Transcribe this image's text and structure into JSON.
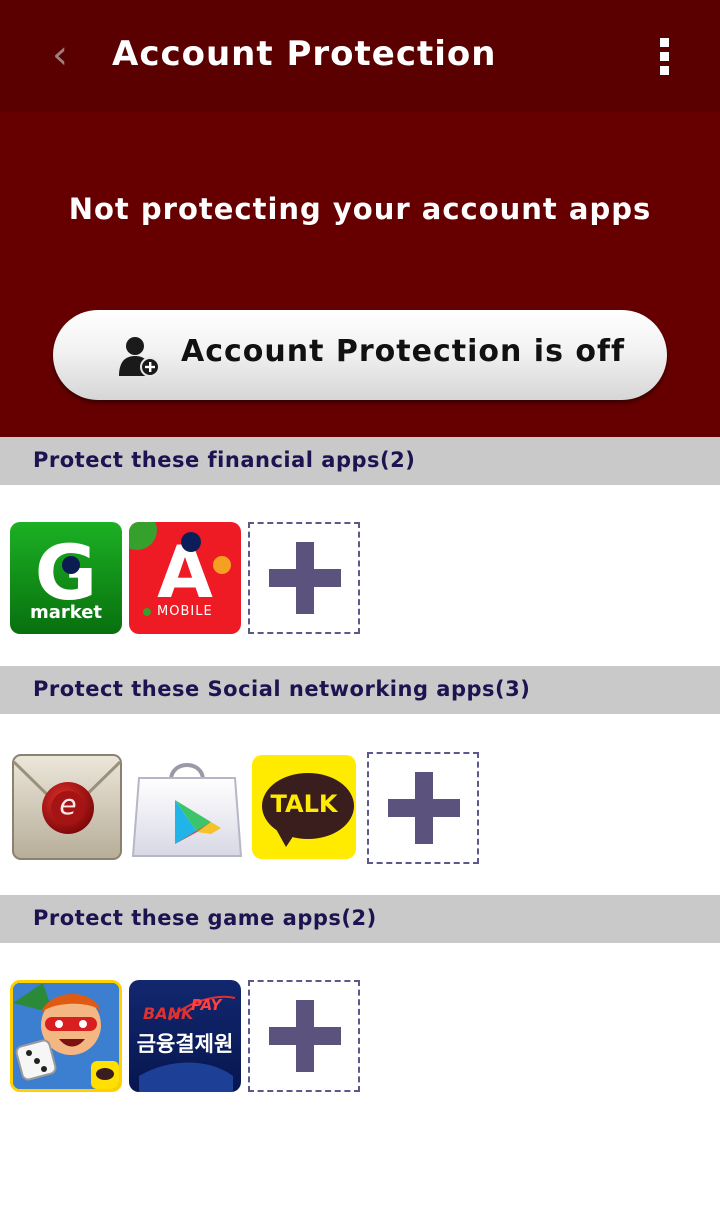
{
  "header": {
    "title": "Account Protection",
    "back_icon": "back-chevron-icon",
    "menu_icon": "overflow-menu-icon"
  },
  "hero": {
    "status_text": "Not protecting your account apps",
    "toggle_label": "Account Protection is off",
    "toggle_icon": "user-shield-icon"
  },
  "sections": [
    {
      "title": "Protect these financial apps(2)",
      "apps": [
        {
          "name": "G Market",
          "icon_text": "G",
          "icon_subtext": "market"
        },
        {
          "name": "A Mobile",
          "icon_text": "A",
          "icon_subtext": "MOBILE"
        }
      ]
    },
    {
      "title": "Protect these Social networking apps(3)",
      "apps": [
        {
          "name": "E-mail",
          "icon_text": "e"
        },
        {
          "name": "Play Store",
          "icon_text": ""
        },
        {
          "name": "KakaoTalk",
          "icon_text": "TALK"
        }
      ]
    },
    {
      "title": "Protect these game apps(2)",
      "apps": [
        {
          "name": "Game",
          "icon_text": ""
        },
        {
          "name": "BankPay",
          "icon_text": "BANK",
          "icon_text2": "PAY",
          "icon_subtext": "금융결제원"
        }
      ]
    }
  ],
  "colors": {
    "appbar": "#5b0000",
    "hero": "#660000",
    "section_header": "#c9c9c9",
    "plus": "#5c527e"
  }
}
